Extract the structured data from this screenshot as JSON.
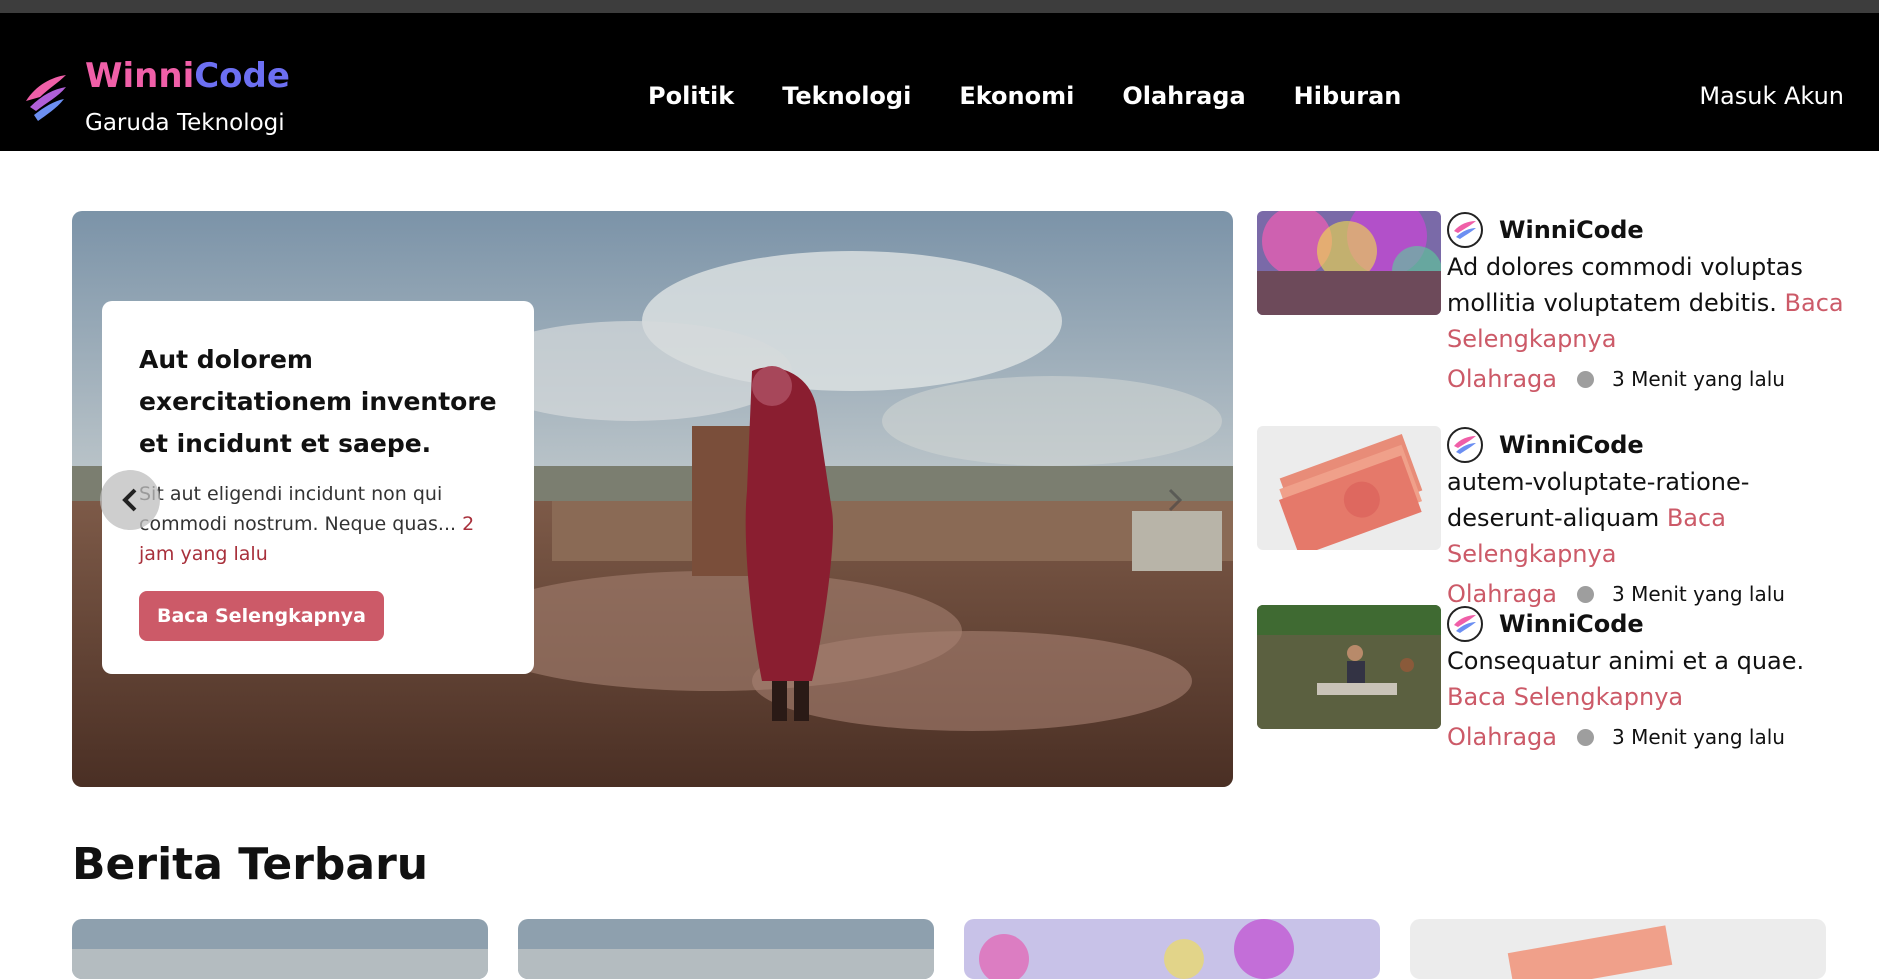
{
  "brand": {
    "name_part1": "Winni",
    "name_part2": "Code",
    "tagline": "Garuda Teknologi"
  },
  "nav": {
    "items": [
      {
        "label": "Politik"
      },
      {
        "label": "Teknologi"
      },
      {
        "label": "Ekonomi"
      },
      {
        "label": "Olahraga"
      },
      {
        "label": "Hiburan"
      }
    ]
  },
  "login_label": "Masuk Akun",
  "hero": {
    "title": "Aut dolorem exercitationem inventore et incidunt et saepe.",
    "excerpt": "Sit aut eligendi incidunt non qui commodi nostrum. Neque quas...",
    "time": "2 jam yang lalu",
    "button": "Baca Selengkapnya"
  },
  "side_news": [
    {
      "author": "WinniCode",
      "text": "Ad dolores commodi voluptas mollitia voluptatem debitis.",
      "link": "Baca Selengkapnya",
      "category": "Olahraga",
      "time": "3 Menit yang lalu",
      "image": "holi-festival"
    },
    {
      "author": "WinniCode",
      "text": "autem-voluptate-ratione-deserunt-aliquam",
      "link": "Baca Selengkapnya",
      "category": "Olahraga",
      "time": "3 Menit yang lalu",
      "image": "euro-banknotes"
    },
    {
      "author": "WinniCode",
      "text": "Consequatur animi et a quae.",
      "link": "Baca Selengkapnya",
      "category": "Olahraga",
      "time": "3 Menit yang lalu",
      "image": "flood-raft"
    }
  ],
  "section_title": "Berita Terbaru",
  "colors": {
    "accent": "#cc5a68",
    "navbar": "#000000",
    "brand_pink": "#f05fa8",
    "brand_blue": "#6c6ff2"
  }
}
